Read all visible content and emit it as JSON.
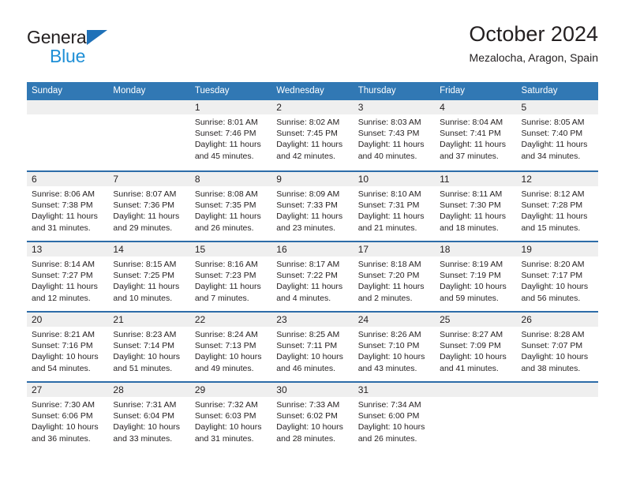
{
  "brand": {
    "name_top": "General",
    "name_bottom": "Blue",
    "triangle_color": "#1f71b8",
    "blue_color": "#1f8fd6"
  },
  "header": {
    "title": "October 2024",
    "subtitle": "Mezalocha, Aragon, Spain"
  },
  "theme": {
    "header_bar": "#3178b4",
    "row_divider": "#2d6ca8",
    "day_band": "#efefef",
    "text": "#231f20"
  },
  "weekday_headers": [
    "Sunday",
    "Monday",
    "Tuesday",
    "Wednesday",
    "Thursday",
    "Friday",
    "Saturday"
  ],
  "weeks": [
    [
      {
        "day": "",
        "lines": []
      },
      {
        "day": "",
        "lines": []
      },
      {
        "day": "1",
        "lines": [
          "Sunrise: 8:01 AM",
          "Sunset: 7:46 PM",
          "Daylight: 11 hours",
          "and 45 minutes."
        ]
      },
      {
        "day": "2",
        "lines": [
          "Sunrise: 8:02 AM",
          "Sunset: 7:45 PM",
          "Daylight: 11 hours",
          "and 42 minutes."
        ]
      },
      {
        "day": "3",
        "lines": [
          "Sunrise: 8:03 AM",
          "Sunset: 7:43 PM",
          "Daylight: 11 hours",
          "and 40 minutes."
        ]
      },
      {
        "day": "4",
        "lines": [
          "Sunrise: 8:04 AM",
          "Sunset: 7:41 PM",
          "Daylight: 11 hours",
          "and 37 minutes."
        ]
      },
      {
        "day": "5",
        "lines": [
          "Sunrise: 8:05 AM",
          "Sunset: 7:40 PM",
          "Daylight: 11 hours",
          "and 34 minutes."
        ]
      }
    ],
    [
      {
        "day": "6",
        "lines": [
          "Sunrise: 8:06 AM",
          "Sunset: 7:38 PM",
          "Daylight: 11 hours",
          "and 31 minutes."
        ]
      },
      {
        "day": "7",
        "lines": [
          "Sunrise: 8:07 AM",
          "Sunset: 7:36 PM",
          "Daylight: 11 hours",
          "and 29 minutes."
        ]
      },
      {
        "day": "8",
        "lines": [
          "Sunrise: 8:08 AM",
          "Sunset: 7:35 PM",
          "Daylight: 11 hours",
          "and 26 minutes."
        ]
      },
      {
        "day": "9",
        "lines": [
          "Sunrise: 8:09 AM",
          "Sunset: 7:33 PM",
          "Daylight: 11 hours",
          "and 23 minutes."
        ]
      },
      {
        "day": "10",
        "lines": [
          "Sunrise: 8:10 AM",
          "Sunset: 7:31 PM",
          "Daylight: 11 hours",
          "and 21 minutes."
        ]
      },
      {
        "day": "11",
        "lines": [
          "Sunrise: 8:11 AM",
          "Sunset: 7:30 PM",
          "Daylight: 11 hours",
          "and 18 minutes."
        ]
      },
      {
        "day": "12",
        "lines": [
          "Sunrise: 8:12 AM",
          "Sunset: 7:28 PM",
          "Daylight: 11 hours",
          "and 15 minutes."
        ]
      }
    ],
    [
      {
        "day": "13",
        "lines": [
          "Sunrise: 8:14 AM",
          "Sunset: 7:27 PM",
          "Daylight: 11 hours",
          "and 12 minutes."
        ]
      },
      {
        "day": "14",
        "lines": [
          "Sunrise: 8:15 AM",
          "Sunset: 7:25 PM",
          "Daylight: 11 hours",
          "and 10 minutes."
        ]
      },
      {
        "day": "15",
        "lines": [
          "Sunrise: 8:16 AM",
          "Sunset: 7:23 PM",
          "Daylight: 11 hours",
          "and 7 minutes."
        ]
      },
      {
        "day": "16",
        "lines": [
          "Sunrise: 8:17 AM",
          "Sunset: 7:22 PM",
          "Daylight: 11 hours",
          "and 4 minutes."
        ]
      },
      {
        "day": "17",
        "lines": [
          "Sunrise: 8:18 AM",
          "Sunset: 7:20 PM",
          "Daylight: 11 hours",
          "and 2 minutes."
        ]
      },
      {
        "day": "18",
        "lines": [
          "Sunrise: 8:19 AM",
          "Sunset: 7:19 PM",
          "Daylight: 10 hours",
          "and 59 minutes."
        ]
      },
      {
        "day": "19",
        "lines": [
          "Sunrise: 8:20 AM",
          "Sunset: 7:17 PM",
          "Daylight: 10 hours",
          "and 56 minutes."
        ]
      }
    ],
    [
      {
        "day": "20",
        "lines": [
          "Sunrise: 8:21 AM",
          "Sunset: 7:16 PM",
          "Daylight: 10 hours",
          "and 54 minutes."
        ]
      },
      {
        "day": "21",
        "lines": [
          "Sunrise: 8:23 AM",
          "Sunset: 7:14 PM",
          "Daylight: 10 hours",
          "and 51 minutes."
        ]
      },
      {
        "day": "22",
        "lines": [
          "Sunrise: 8:24 AM",
          "Sunset: 7:13 PM",
          "Daylight: 10 hours",
          "and 49 minutes."
        ]
      },
      {
        "day": "23",
        "lines": [
          "Sunrise: 8:25 AM",
          "Sunset: 7:11 PM",
          "Daylight: 10 hours",
          "and 46 minutes."
        ]
      },
      {
        "day": "24",
        "lines": [
          "Sunrise: 8:26 AM",
          "Sunset: 7:10 PM",
          "Daylight: 10 hours",
          "and 43 minutes."
        ]
      },
      {
        "day": "25",
        "lines": [
          "Sunrise: 8:27 AM",
          "Sunset: 7:09 PM",
          "Daylight: 10 hours",
          "and 41 minutes."
        ]
      },
      {
        "day": "26",
        "lines": [
          "Sunrise: 8:28 AM",
          "Sunset: 7:07 PM",
          "Daylight: 10 hours",
          "and 38 minutes."
        ]
      }
    ],
    [
      {
        "day": "27",
        "lines": [
          "Sunrise: 7:30 AM",
          "Sunset: 6:06 PM",
          "Daylight: 10 hours",
          "and 36 minutes."
        ]
      },
      {
        "day": "28",
        "lines": [
          "Sunrise: 7:31 AM",
          "Sunset: 6:04 PM",
          "Daylight: 10 hours",
          "and 33 minutes."
        ]
      },
      {
        "day": "29",
        "lines": [
          "Sunrise: 7:32 AM",
          "Sunset: 6:03 PM",
          "Daylight: 10 hours",
          "and 31 minutes."
        ]
      },
      {
        "day": "30",
        "lines": [
          "Sunrise: 7:33 AM",
          "Sunset: 6:02 PM",
          "Daylight: 10 hours",
          "and 28 minutes."
        ]
      },
      {
        "day": "31",
        "lines": [
          "Sunrise: 7:34 AM",
          "Sunset: 6:00 PM",
          "Daylight: 10 hours",
          "and 26 minutes."
        ]
      },
      {
        "day": "",
        "lines": []
      },
      {
        "day": "",
        "lines": []
      }
    ]
  ]
}
